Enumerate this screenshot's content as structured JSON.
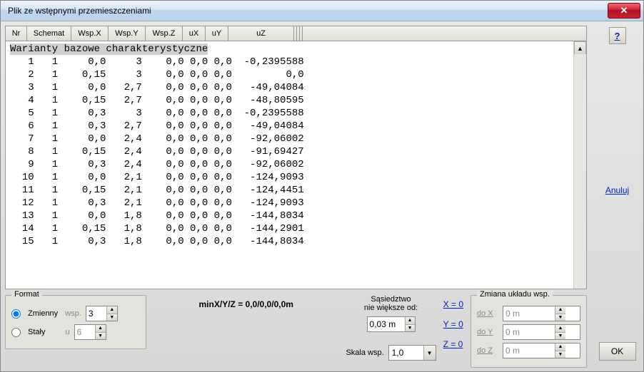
{
  "title": "Plik ze wstępnymi przemieszczeniami",
  "headers": {
    "nr": "Nr",
    "schemat": "Schemat",
    "wspx": "Wsp.X",
    "wspy": "Wsp.Y",
    "wspz": "Wsp.Z",
    "ux": "uX",
    "uy": "uY",
    "uz": "uZ"
  },
  "data_header": "Warianty bazowe charakterystyczne",
  "rows": [
    {
      "nr": 1,
      "sch": 1,
      "x": "0,0",
      "y": "3",
      "z": "0,0",
      "ux": "0,0",
      "uy": "0,0",
      "uz": "-0,2395588"
    },
    {
      "nr": 2,
      "sch": 1,
      "x": "0,15",
      "y": "3",
      "z": "0,0",
      "ux": "0,0",
      "uy": "0,0",
      "uz": "0,0"
    },
    {
      "nr": 3,
      "sch": 1,
      "x": "0,0",
      "y": "2,7",
      "z": "0,0",
      "ux": "0,0",
      "uy": "0,0",
      "uz": "-49,04084"
    },
    {
      "nr": 4,
      "sch": 1,
      "x": "0,15",
      "y": "2,7",
      "z": "0,0",
      "ux": "0,0",
      "uy": "0,0",
      "uz": "-48,80595"
    },
    {
      "nr": 5,
      "sch": 1,
      "x": "0,3",
      "y": "3",
      "z": "0,0",
      "ux": "0,0",
      "uy": "0,0",
      "uz": "-0,2395588"
    },
    {
      "nr": 6,
      "sch": 1,
      "x": "0,3",
      "y": "2,7",
      "z": "0,0",
      "ux": "0,0",
      "uy": "0,0",
      "uz": "-49,04084"
    },
    {
      "nr": 7,
      "sch": 1,
      "x": "0,0",
      "y": "2,4",
      "z": "0,0",
      "ux": "0,0",
      "uy": "0,0",
      "uz": "-92,06002"
    },
    {
      "nr": 8,
      "sch": 1,
      "x": "0,15",
      "y": "2,4",
      "z": "0,0",
      "ux": "0,0",
      "uy": "0,0",
      "uz": "-91,69427"
    },
    {
      "nr": 9,
      "sch": 1,
      "x": "0,3",
      "y": "2,4",
      "z": "0,0",
      "ux": "0,0",
      "uy": "0,0",
      "uz": "-92,06002"
    },
    {
      "nr": 10,
      "sch": 1,
      "x": "0,0",
      "y": "2,1",
      "z": "0,0",
      "ux": "0,0",
      "uy": "0,0",
      "uz": "-124,9093"
    },
    {
      "nr": 11,
      "sch": 1,
      "x": "0,15",
      "y": "2,1",
      "z": "0,0",
      "ux": "0,0",
      "uy": "0,0",
      "uz": "-124,4451"
    },
    {
      "nr": 12,
      "sch": 1,
      "x": "0,3",
      "y": "2,1",
      "z": "0,0",
      "ux": "0,0",
      "uy": "0,0",
      "uz": "-124,9093"
    },
    {
      "nr": 13,
      "sch": 1,
      "x": "0,0",
      "y": "1,8",
      "z": "0,0",
      "ux": "0,0",
      "uy": "0,0",
      "uz": "-144,8034"
    },
    {
      "nr": 14,
      "sch": 1,
      "x": "0,15",
      "y": "1,8",
      "z": "0,0",
      "ux": "0,0",
      "uy": "0,0",
      "uz": "-144,2901"
    },
    {
      "nr": 15,
      "sch": 1,
      "x": "0,3",
      "y": "1,8",
      "z": "0,0",
      "ux": "0,0",
      "uy": "0,0",
      "uz": "-144,8034"
    }
  ],
  "format": {
    "legend": "Format",
    "zmienny": "Zmienny",
    "wsp_lbl": "wsp.",
    "wsp_val": "3",
    "staly": "Stały",
    "u_lbl": "u",
    "u_val": "6"
  },
  "minline": "minX/Y/Z = 0,0/0,0/0,0m",
  "sasiedztwo": {
    "l1": "Sąsiedztwo",
    "l2": "nie większe od:",
    "val": "0,03 m"
  },
  "links": {
    "x": "X = 0",
    "y": "Y = 0",
    "z": "Z = 0"
  },
  "skala": {
    "label": "Skala wsp.",
    "val": "1,0"
  },
  "zmiana": {
    "legend": "Zmiana układu wsp.",
    "dox": "do X",
    "doy": "do Y",
    "doz": "do Z",
    "val": "0 m"
  },
  "side": {
    "help": "?",
    "anuluj": "Anuluj",
    "ok": "OK"
  }
}
